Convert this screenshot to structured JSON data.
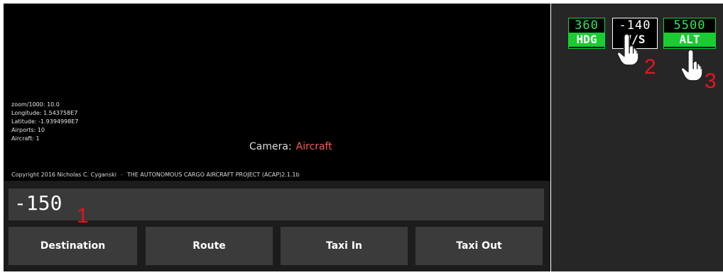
{
  "map": {
    "info_lines": [
      "zoom/1000: 10.0",
      "Longitude: 1.543758E7",
      "Latitude: -1.9394998E7",
      "Airports: 10",
      "Aircraft: 1"
    ],
    "camera_label": "Camera:",
    "camera_value": "Aircraft",
    "copyright": "Copyright 2016 Nicholas C. Cyganski",
    "separator": "-",
    "project": "THE AUTONOMOUS CARGO AIRCRAFT PROJECT (ACAP)2.1.1b"
  },
  "entry": {
    "value": "-150"
  },
  "buttons": {
    "destination": "Destination",
    "route": "Route",
    "taxi_in": "Taxi In",
    "taxi_out": "Taxi Out"
  },
  "autopilot": {
    "hdg": {
      "value": "360",
      "label": "HDG"
    },
    "vs": {
      "value": "-140",
      "label": "V/S"
    },
    "alt": {
      "value": "5500",
      "label": "ALT"
    }
  },
  "markers": [
    "1",
    "2",
    "3"
  ],
  "colors": {
    "accent_green": "#18cc32",
    "camera_value": "#ff5a5a",
    "marker_red": "#e8141c"
  },
  "icons": {
    "cursor": "pointing-hand-icon"
  }
}
